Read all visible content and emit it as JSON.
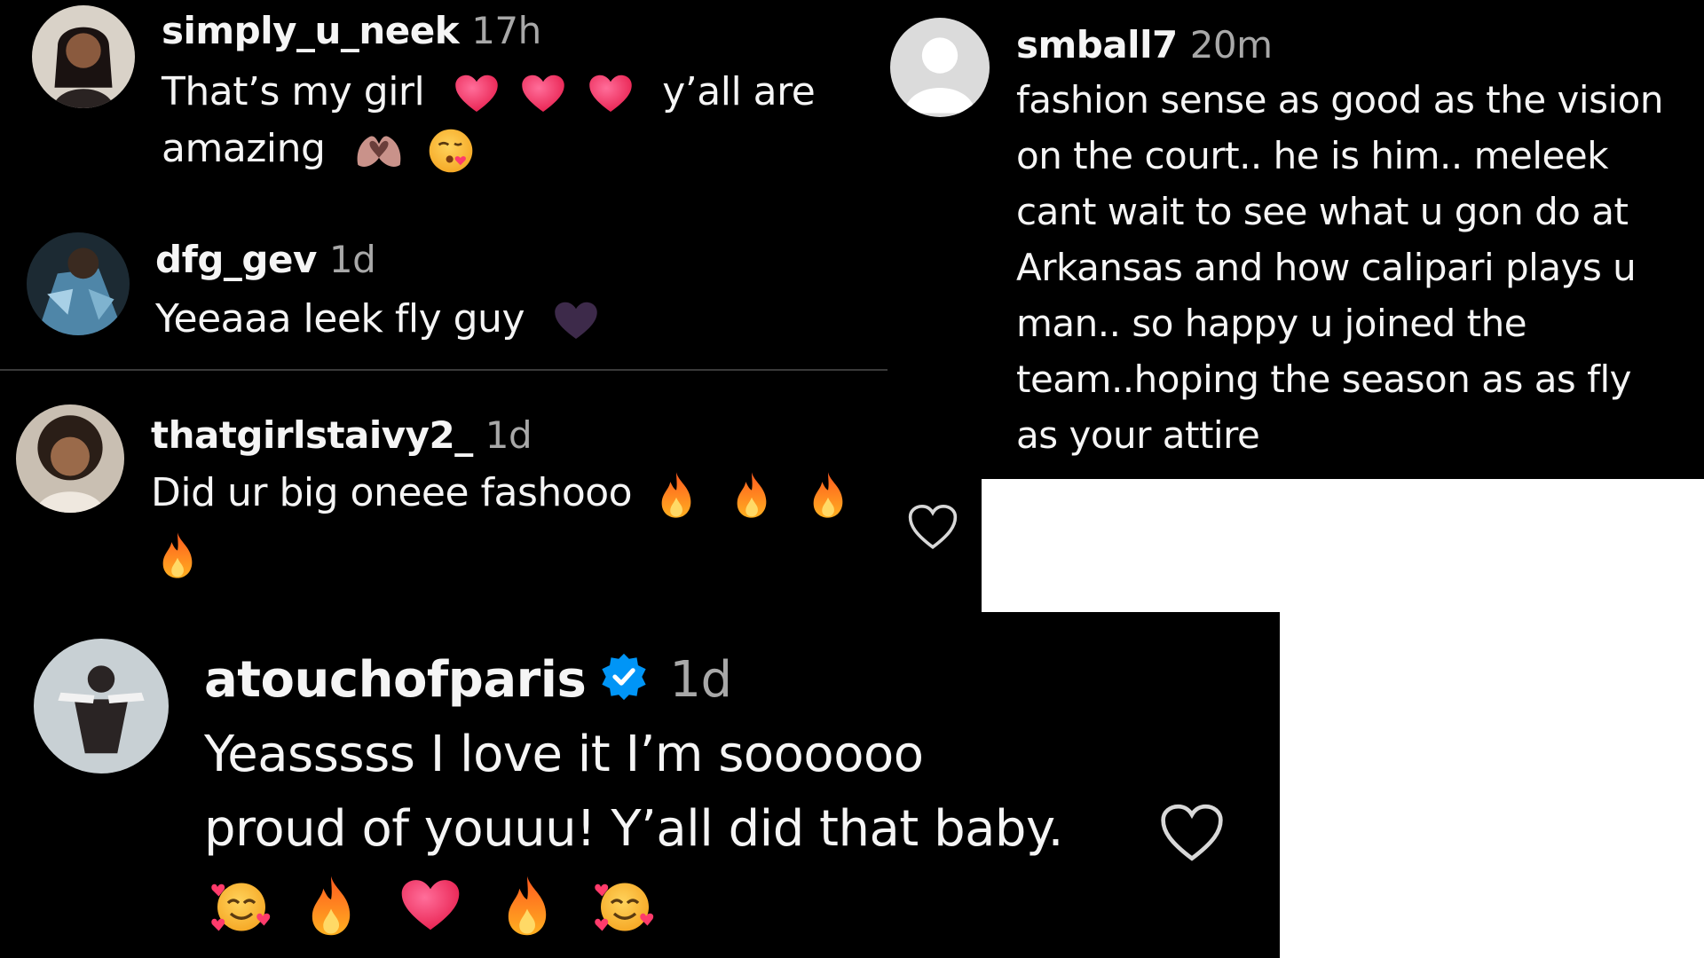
{
  "colors": {
    "background": "#000000",
    "username": "#f5f5f5",
    "text": "#f5f5f5",
    "timestamp": "#a8a8a8",
    "verified": "#0095f6",
    "heart_emoji": "#ff3b6b",
    "fire_emoji": "#ff8a1f",
    "purple_heart": "#3d2a4a"
  },
  "comments": [
    {
      "username": "simply_u_neek",
      "time": "17h",
      "line1_before": "That’s my girl",
      "line1_after": "y’all are",
      "line2": "amazing",
      "emojis_line1": [
        "red-heart-icon",
        "red-heart-icon",
        "red-heart-icon"
      ],
      "emojis_line2": [
        "heart-hands-icon",
        "face-blowing-kiss-icon"
      ]
    },
    {
      "username": "dfg_gev",
      "time": "1d",
      "line1": "Yeeaaa leek fly guy",
      "emojis_line1": [
        "black-heart-icon"
      ]
    },
    {
      "username": "thatgirlstaivy2_",
      "time": "1d",
      "line1": "Did ur big oneee fashooo",
      "emojis_line1": [
        "fire-icon",
        "fire-icon",
        "fire-icon"
      ],
      "emojis_line2": [
        "fire-icon"
      ]
    },
    {
      "username": "smball7",
      "time": "20m",
      "lines": [
        "fashion sense as good as the vision",
        "on the court.. he is him.. meleek",
        "cant wait to see what u gon do at",
        "Arkansas and how calipari plays u",
        "man.. so happy u joined the",
        "team..hoping the season as as fly",
        "as your attire"
      ]
    },
    {
      "username": "atouchofparis",
      "time": "1d",
      "verified": true,
      "line1": "Yeasssss I love it I’m soooooo",
      "line2": "proud of youuu! Y’all did that baby.",
      "emojis_line3": [
        "smiling-face-with-hearts-icon",
        "fire-icon",
        "red-heart-icon",
        "fire-icon",
        "smiling-face-with-hearts-icon"
      ]
    }
  ]
}
